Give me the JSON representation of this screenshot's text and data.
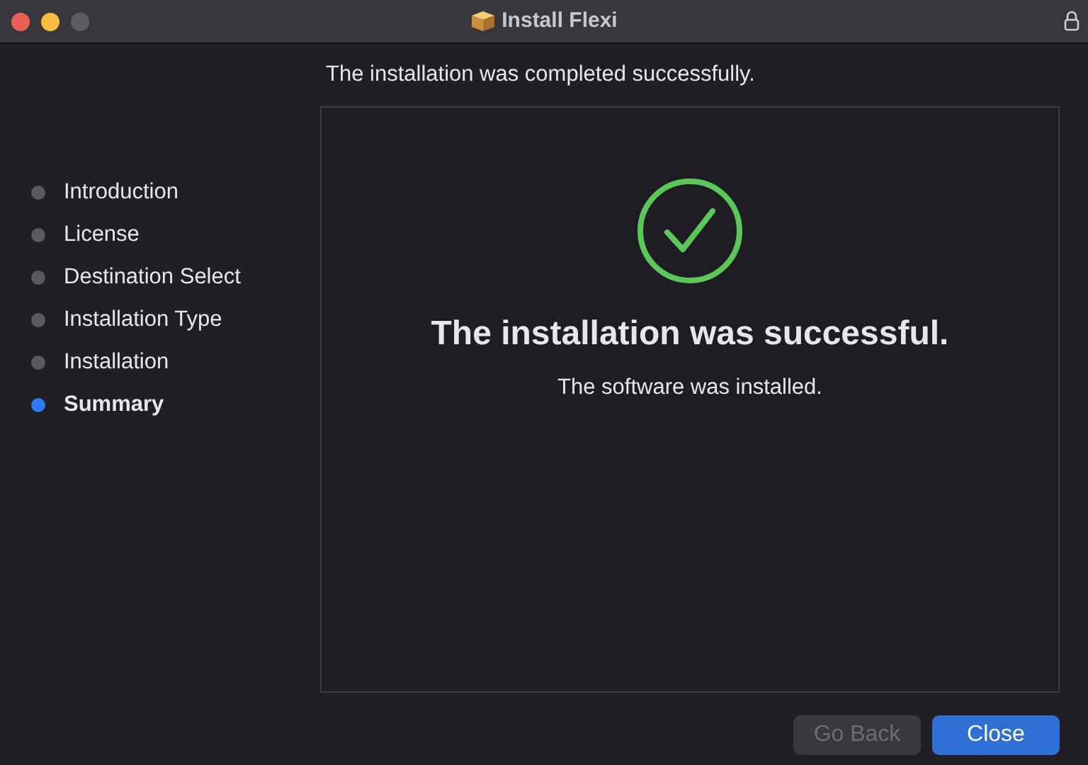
{
  "window": {
    "title": "Install Flexi"
  },
  "steps": [
    {
      "label": "Introduction",
      "selected": false
    },
    {
      "label": "License",
      "selected": false
    },
    {
      "label": "Destination Select",
      "selected": false
    },
    {
      "label": "Installation Type",
      "selected": false
    },
    {
      "label": "Installation",
      "selected": false
    },
    {
      "label": "Summary",
      "selected": true
    }
  ],
  "header": "The installation was completed successfully.",
  "panel": {
    "heading": "The installation was successful.",
    "message": "The software was installed."
  },
  "buttons": [
    {
      "label": "Go Back",
      "disabled": true,
      "kind": "secondary"
    },
    {
      "label": "Close",
      "disabled": false,
      "kind": "primary"
    }
  ]
}
